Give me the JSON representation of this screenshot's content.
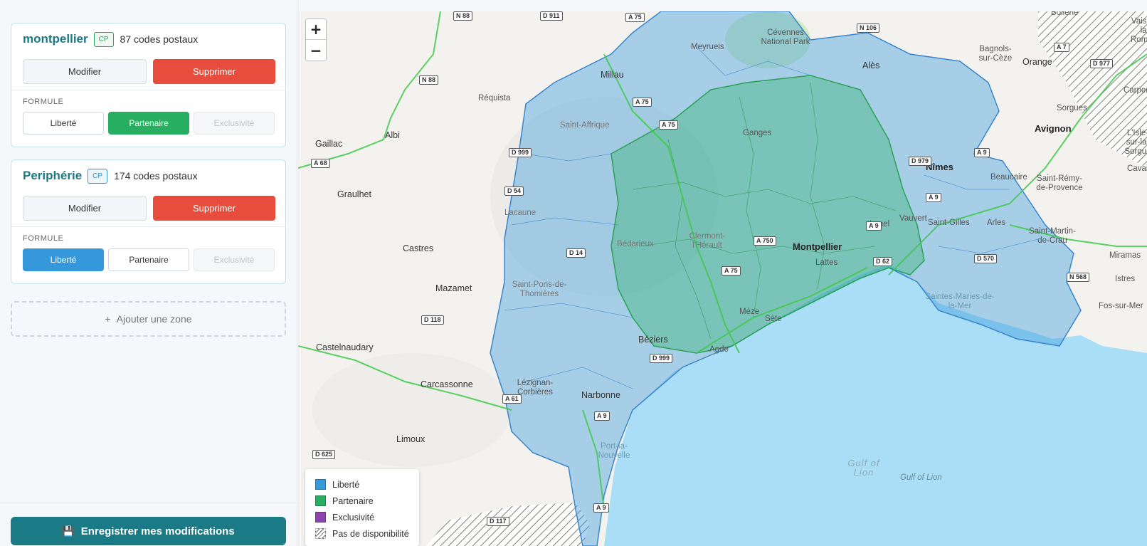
{
  "zones": [
    {
      "name": "montpellier",
      "badge": "CP",
      "count": "87 codes postaux",
      "edit_label": "Modifier",
      "delete_label": "Supprimer",
      "formule_label": "FORMULE",
      "formules": [
        "Liberté",
        "Partenaire",
        "Exclusivité"
      ],
      "selected_formule": "Partenaire"
    },
    {
      "name": "Periphérie",
      "badge": "CP",
      "count": "174 codes postaux",
      "edit_label": "Modifier",
      "delete_label": "Supprimer",
      "formule_label": "FORMULE",
      "formules": [
        "Liberté",
        "Partenaire",
        "Exclusivité"
      ],
      "selected_formule": "Liberté"
    }
  ],
  "add_zone": {
    "icon": "+",
    "label": "Ajouter une zone"
  },
  "save": {
    "icon": "floppy-disk-icon",
    "label": "Enregistrer mes modifications"
  },
  "map": {
    "zoom_in": "+",
    "zoom_out": "−",
    "legend": [
      {
        "label": "Liberté",
        "color": "#3498db"
      },
      {
        "label": "Partenaire",
        "color": "#27ae60"
      },
      {
        "label": "Exclusivité",
        "color": "#8e44ad"
      },
      {
        "label": "Pas de disponibilité",
        "color": "hatched"
      }
    ],
    "places": {
      "montpellier": "Montpellier",
      "nimes": "Nîmes",
      "avignon": "Avignon",
      "beziers": "Béziers",
      "narbonne": "Narbonne",
      "sete": "Sète",
      "agde": "Agde",
      "lunel": "Lunel",
      "lattes": "Lattes",
      "meze": "Mèze",
      "ganges": "Ganges",
      "millau": "Millau",
      "meyrueis": "Meyrueis",
      "cevennes": "Cévennes National Park",
      "ales": "Alès",
      "bagnols": "Bagnols-sur-Cèze",
      "orange": "Orange",
      "sorgues": "Sorgues",
      "beaucaire": "Beaucaire",
      "saint_remy": "Saint-Rémy-de-Provence",
      "arles": "Arles",
      "saint_gilles": "Saint-Gilles",
      "vauvert": "Vauvert",
      "saint_martin": "Saint-Martin-de-Crau",
      "istres": "Istres",
      "miramas": "Miramas",
      "fos": "Fos-sur-Mer",
      "saintes_maries": "Saintes-Maries-de-la-Mer",
      "clermont": "Clermont-l'Hérault",
      "bedarieux": "Bédarieux",
      "lacaune": "Lacaune",
      "saint_pons": "Saint-Pons-de-Thomières",
      "saint_affrique": "Saint-Affrique",
      "requista": "Réquista",
      "albi": "Albi",
      "gaillac": "Gaillac",
      "graulhet": "Graulhet",
      "castres": "Castres",
      "mazamet": "Mazamet",
      "castelnaudary": "Castelnaudary",
      "carcassonne": "Carcassonne",
      "limoux": "Limoux",
      "lezignan": "Lézignan-Corbières",
      "port_la_nouvelle": "Port-la-Nouvelle",
      "gulf_a": "Gulf of Lion",
      "gulf_b": "Gulf of Lion",
      "bollene": "Bollène",
      "vaison": "Vaison-la-Romaine",
      "carpentras": "Carpentras",
      "lisle": "L'Isle-sur-la-Sorgue",
      "cavaillon": "Cavaillon"
    },
    "roads": [
      "N 88",
      "D 911",
      "A 75",
      "N 106",
      "N 88",
      "A 75",
      "A 75",
      "D 999",
      "A 68",
      "D 54",
      "D 14",
      "D 118",
      "A 61",
      "A 9",
      "A 9",
      "D 625",
      "D 117",
      "A 750",
      "A 75",
      "A 9",
      "D 62",
      "D 979",
      "A 9",
      "D 570",
      "N 568",
      "A 7",
      "D 977",
      "A 9",
      "D 999"
    ]
  }
}
